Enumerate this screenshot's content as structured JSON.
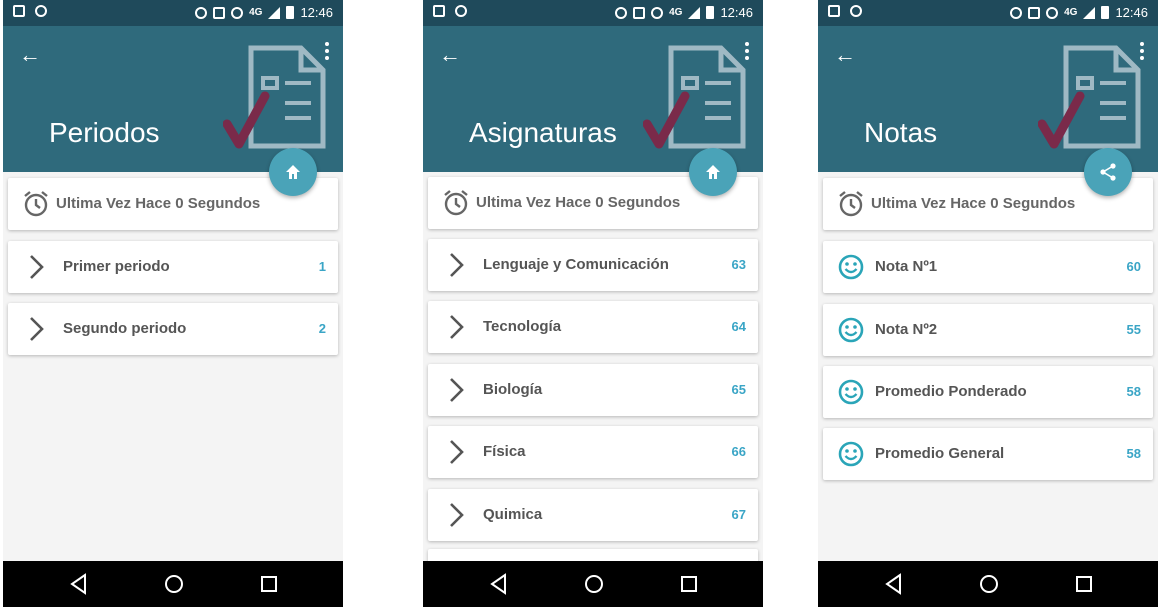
{
  "status_bar": {
    "time": "12:46",
    "network": "4G"
  },
  "screens": [
    {
      "title": "Periodos",
      "fab_icon": "home-icon",
      "last_update": "Ultima Vez Hace 0 Segundos",
      "items": [
        {
          "label": "Primer periodo",
          "value": "1",
          "icon": "chevron-right-icon"
        },
        {
          "label": "Segundo periodo",
          "value": "2",
          "icon": "chevron-right-icon"
        }
      ]
    },
    {
      "title": "Asignaturas",
      "fab_icon": "home-icon",
      "last_update": "Ultima Vez Hace 0 Segundos",
      "items": [
        {
          "label": "Lenguaje y Comunicación",
          "value": "63",
          "icon": "chevron-right-icon"
        },
        {
          "label": "Tecnología",
          "value": "64",
          "icon": "chevron-right-icon"
        },
        {
          "label": "Biología",
          "value": "65",
          "icon": "chevron-right-icon"
        },
        {
          "label": "Física",
          "value": "66",
          "icon": "chevron-right-icon"
        },
        {
          "label": "Quimica",
          "value": "67",
          "icon": "chevron-right-icon"
        }
      ]
    },
    {
      "title": "Notas",
      "fab_icon": "share-icon",
      "last_update": "Ultima Vez Hace 0 Segundos",
      "items": [
        {
          "label": "Nota Nº1",
          "value": "60",
          "icon": "smiley-icon"
        },
        {
          "label": "Nota Nº2",
          "value": "55",
          "icon": "smiley-icon"
        },
        {
          "label": "Promedio Ponderado",
          "value": "58",
          "icon": "smiley-icon"
        },
        {
          "label": "Promedio General",
          "value": "58",
          "icon": "smiley-icon"
        }
      ]
    }
  ],
  "colors": {
    "status_bar": "#1f4a5b",
    "header": "#2f6a7c",
    "fab": "#4aa3b8",
    "accent_value": "#3aa5c6",
    "checkmark": "#7a2a4a",
    "background": "#f4f4f4"
  }
}
